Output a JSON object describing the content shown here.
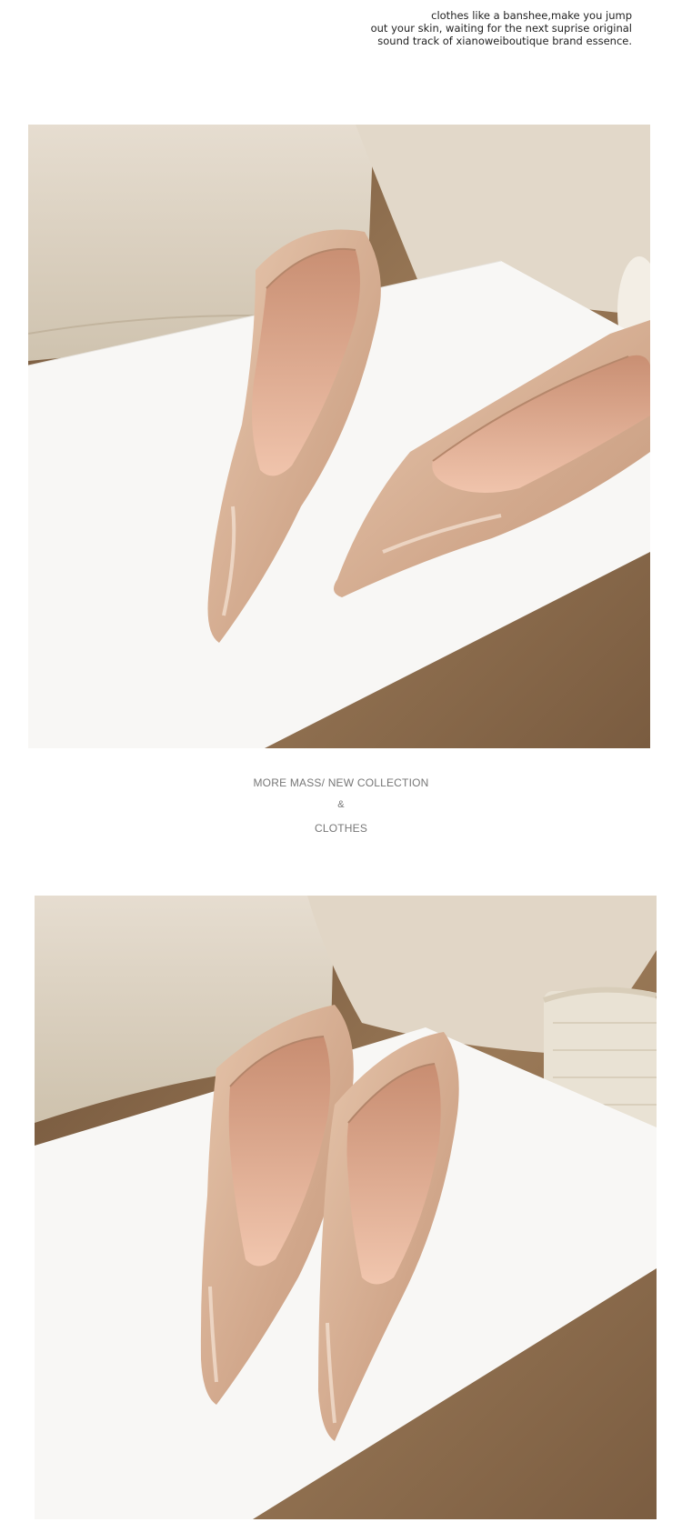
{
  "tagline": {
    "line1": "clothes like a banshee,make you jump",
    "line2": "out your skin, waiting for the next suprise original",
    "line3": "sound track of xianoweiboutique brand essence."
  },
  "caption": {
    "line1": "MORE MASS/ NEW COLLECTION",
    "line2": "&",
    "line3": "CLOTHES"
  },
  "photos": [
    {
      "subject": "nude patent leather pointed-toe pumps, pair, angled on white sheet over fur rug"
    },
    {
      "subject": "nude patent leather pointed-toe pumps, pair, side by side with tweed bag"
    }
  ],
  "colors": {
    "pillow": "#ddd3c2",
    "fur": "#8a6a4c",
    "sheet": "#f8f7f5",
    "shoe": "#d9b49a",
    "insole": "#e8b9a0"
  }
}
